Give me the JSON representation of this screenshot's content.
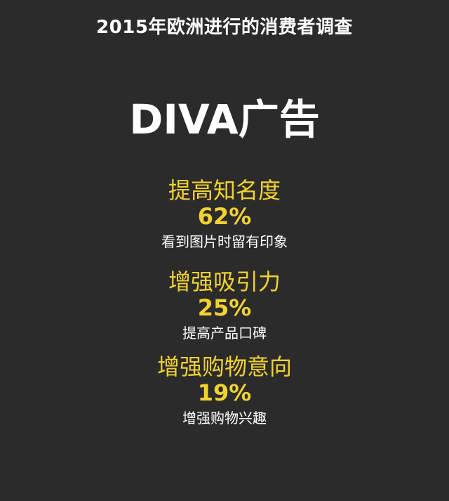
{
  "header": {
    "survey_title": "2015年欧洲进行的消费者调查"
  },
  "main": {
    "title": "DIVA广告"
  },
  "stats": [
    {
      "heading": "提高知名度",
      "percent": "62%",
      "description": "看到图片时留有印象"
    },
    {
      "heading": "增强吸引力",
      "percent": "25%",
      "description": "提高产品口碑"
    },
    {
      "heading": "增强购物意向",
      "percent": "19%",
      "description": "增强购物兴趣"
    }
  ],
  "colors": {
    "background": "#2b2b2b",
    "accent": "#f2d231",
    "text": "#ffffff"
  }
}
